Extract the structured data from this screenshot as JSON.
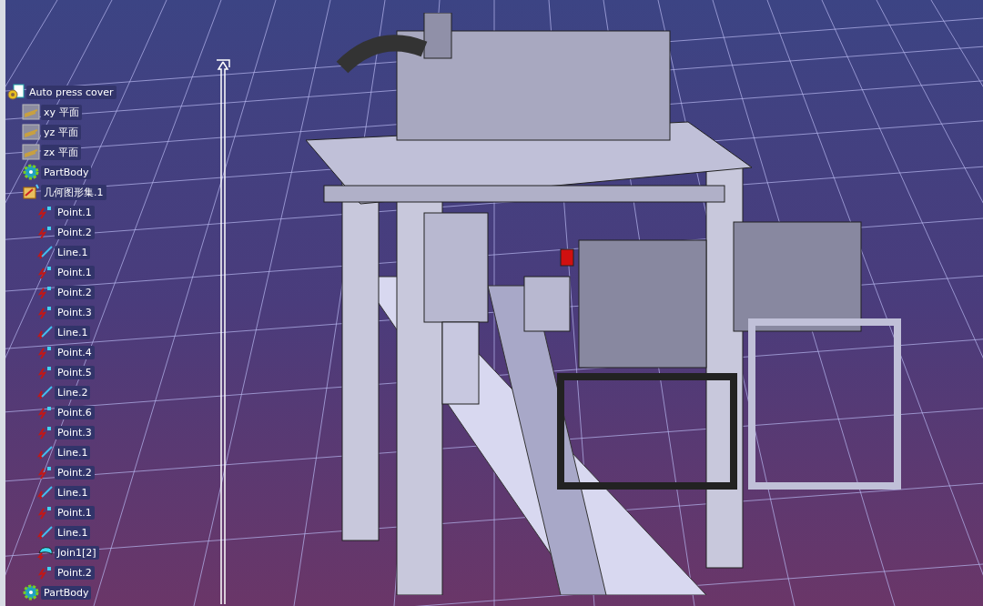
{
  "tree": {
    "label": "Auto press cover",
    "kind": "root",
    "children": [
      {
        "label": "xy 平面",
        "kind": "plane"
      },
      {
        "label": "yz 平面",
        "kind": "plane"
      },
      {
        "label": "zx 平面",
        "kind": "plane"
      },
      {
        "label": "PartBody",
        "kind": "body"
      },
      {
        "label": "几何图形集.1",
        "kind": "set",
        "children": [
          {
            "label": "Point.1",
            "kind": "point"
          },
          {
            "label": "Point.2",
            "kind": "point"
          },
          {
            "label": "Line.1",
            "kind": "line"
          },
          {
            "label": "Point.1",
            "kind": "point"
          },
          {
            "label": "Point.2",
            "kind": "point"
          },
          {
            "label": "Point.3",
            "kind": "point"
          },
          {
            "label": "Line.1",
            "kind": "line"
          },
          {
            "label": "Point.4",
            "kind": "point"
          },
          {
            "label": "Point.5",
            "kind": "point"
          },
          {
            "label": "Line.2",
            "kind": "line"
          },
          {
            "label": "Point.6",
            "kind": "point"
          },
          {
            "label": "Point.3",
            "kind": "point"
          },
          {
            "label": "Line.1",
            "kind": "line"
          },
          {
            "label": "Point.2",
            "kind": "point"
          },
          {
            "label": "Line.1",
            "kind": "line"
          },
          {
            "label": "Point.1",
            "kind": "point"
          },
          {
            "label": "Line.1",
            "kind": "line"
          },
          {
            "label": "Join1[2]",
            "kind": "join"
          },
          {
            "label": "Point.2",
            "kind": "point"
          }
        ]
      },
      {
        "label": "PartBody",
        "kind": "body"
      }
    ]
  }
}
